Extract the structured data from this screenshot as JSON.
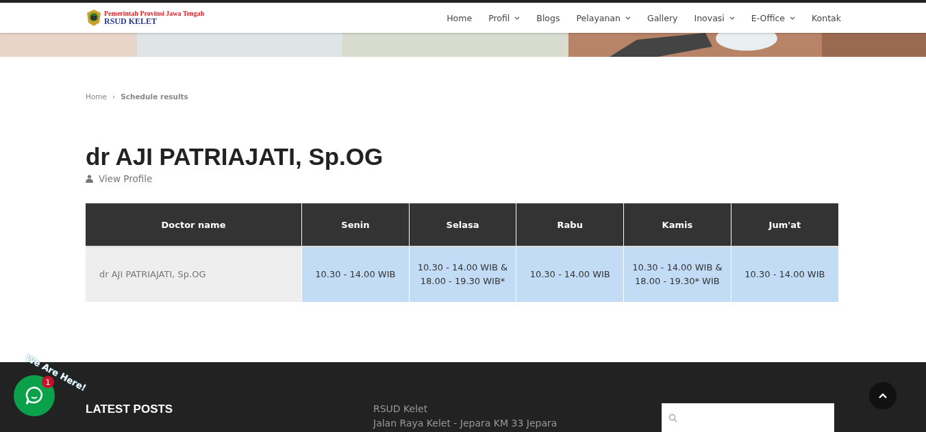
{
  "header": {
    "logo_line1": "Pemerintah Provinsi Jawa Tengah",
    "logo_line2": "RSUD KELET",
    "nav": [
      {
        "label": "Home",
        "dropdown": false
      },
      {
        "label": "Profil",
        "dropdown": true
      },
      {
        "label": "Blogs",
        "dropdown": false
      },
      {
        "label": "Pelayanan",
        "dropdown": true
      },
      {
        "label": "Gallery",
        "dropdown": false
      },
      {
        "label": "Inovasi",
        "dropdown": true
      },
      {
        "label": "E-Office",
        "dropdown": true
      },
      {
        "label": "Kontak",
        "dropdown": false
      }
    ]
  },
  "breadcrumb": [
    {
      "label": "Home",
      "separator": "›"
    },
    {
      "label": "Schedule results"
    }
  ],
  "title": "dr AJI PATRIAJATI, Sp.OG",
  "profile_link": "View Profile",
  "table": {
    "columns": [
      "Doctor name",
      "Senin",
      "Selasa",
      "Rabu",
      "Kamis",
      "Jum'at"
    ],
    "rows": [
      [
        "dr AJI PATRIAJATI, Sp.OG",
        "10.30 - 14.00 WIB",
        "10.30 - 14.00 WIB & 18.00 - 19.30 WIB*",
        "10.30 - 14.00 WIB",
        "10.30 - 14.00 WIB & 18.00 - 19.30* WIB",
        "10.30 - 14.00 WIB"
      ]
    ]
  },
  "chat_widget": {
    "caption": "We Are Here!",
    "badge": "1"
  },
  "footer": {
    "heading": "LATEST POSTS",
    "address": [
      "RSUD Kelet",
      "Jalan Raya Kelet - Jepara KM 33 Jepara"
    ],
    "search_box": true
  }
}
